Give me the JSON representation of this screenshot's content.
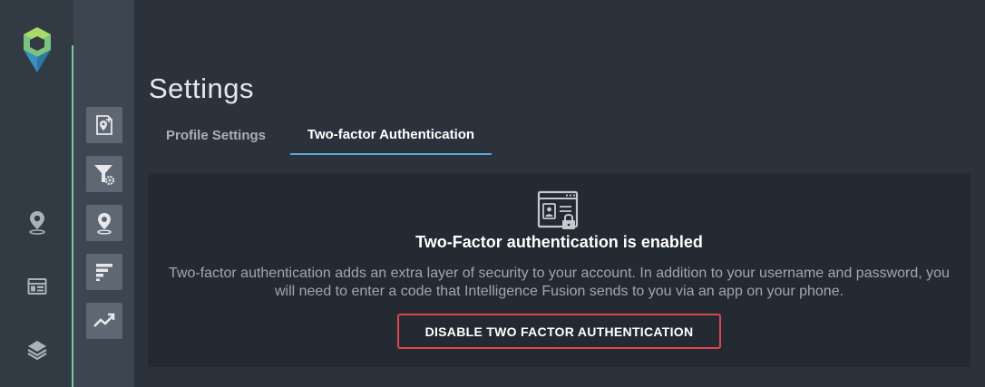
{
  "nav_rail": {
    "logo": "intelligence-fusion-logo",
    "items": [
      {
        "icon": "map-pin-icon"
      },
      {
        "icon": "calendar-grid-icon"
      },
      {
        "icon": "layers-icon"
      }
    ],
    "accent_color": "#6fcf97"
  },
  "tool_panel": {
    "items": [
      {
        "icon": "map-add-icon"
      },
      {
        "icon": "filter-settings-icon"
      },
      {
        "icon": "location-pin-icon"
      },
      {
        "icon": "bar-list-icon"
      },
      {
        "icon": "trend-up-icon"
      }
    ]
  },
  "page": {
    "title": "Settings"
  },
  "tabs": [
    {
      "label": "Profile Settings",
      "active": false
    },
    {
      "label": "Two-factor Authentication",
      "active": true
    }
  ],
  "card": {
    "icon": "security-window-lock-icon",
    "heading": "Two-Factor authentication is enabled",
    "description": "Two-factor authentication adds an extra layer of security to your account. In addition to your username and password, you will need to enter a code that Intelligence Fusion sends to you via an app on your phone.",
    "button_label": "DISABLE TWO FACTOR AUTHENTICATION",
    "button_color": "#e0454f"
  },
  "colors": {
    "background": "#2c323b",
    "tab_underline": "#5aa9d6"
  }
}
